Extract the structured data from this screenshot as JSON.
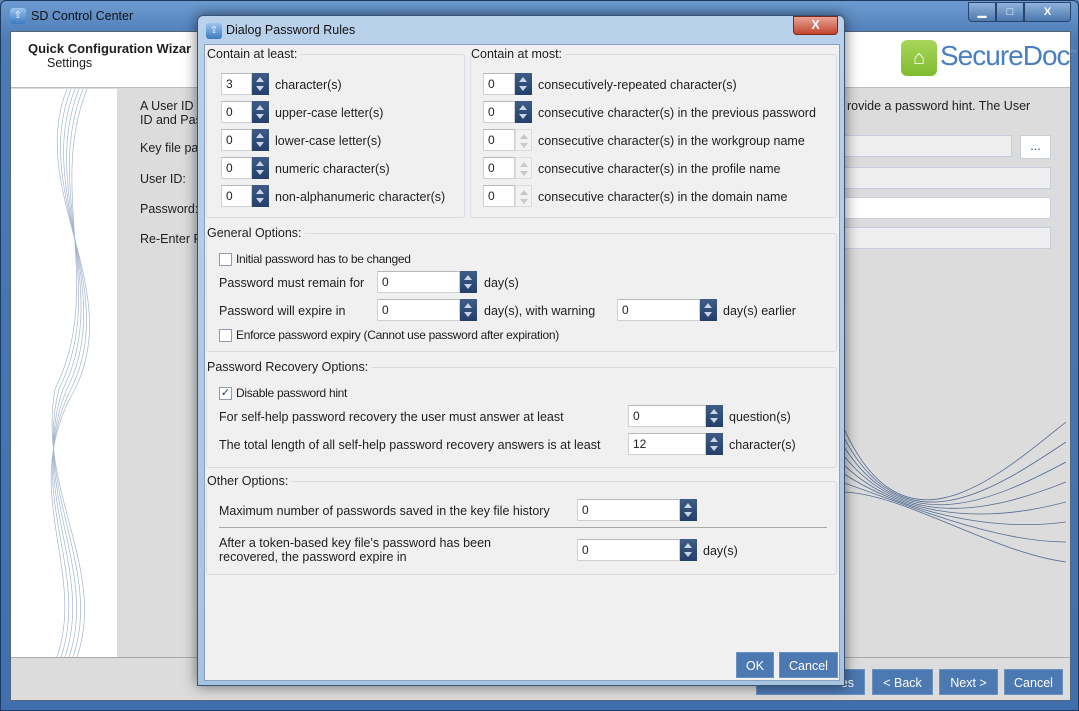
{
  "app": {
    "title": "SD Control Center",
    "window_controls": {
      "minimize": "▁",
      "maximize": "□",
      "close": "X"
    },
    "header": {
      "title": "Quick Configuration Wizar",
      "subtitle": "Settings",
      "logo_text": "SecureDoc",
      "logo_tm": "™"
    },
    "body": {
      "intro_line1_left": "A User ID",
      "intro_line1_right": "rovide a password hint. The User",
      "intro_line2": "ID and Pas",
      "key_file_label": "Key file pa",
      "user_id_label": "User ID:",
      "password_label": "Password:",
      "reenter_label": "Re-Enter P",
      "browse_label": "..."
    },
    "footer": {
      "hidden_button_label": "es",
      "back": "< Back",
      "next": "Next >",
      "cancel": "Cancel"
    }
  },
  "dialog": {
    "title": "Dialog Password Rules",
    "close": "X",
    "contain_least": {
      "legend": "Contain at least:",
      "rows": [
        {
          "value": "3",
          "label": "character(s)"
        },
        {
          "value": "0",
          "label": "upper-case letter(s)"
        },
        {
          "value": "0",
          "label": "lower-case letter(s)"
        },
        {
          "value": "0",
          "label": "numeric character(s)"
        },
        {
          "value": "0",
          "label": "non-alphanumeric character(s)"
        }
      ]
    },
    "contain_most": {
      "legend": "Contain at most:",
      "rows": [
        {
          "value": "0",
          "label": "consecutively-repeated character(s)",
          "enabled": true
        },
        {
          "value": "0",
          "label": "consecutive character(s) in the previous password",
          "enabled": true
        },
        {
          "value": "0",
          "label": "consecutive character(s) in the workgroup name",
          "enabled": false
        },
        {
          "value": "0",
          "label": "consecutive character(s) in the profile name",
          "enabled": false
        },
        {
          "value": "0",
          "label": "consecutive character(s) in the domain name",
          "enabled": false
        }
      ]
    },
    "general": {
      "legend": "General Options:",
      "initial_change": {
        "label": "Initial password has to be changed",
        "checked": false
      },
      "remain_label": "Password must remain for",
      "remain_value": "0",
      "remain_unit": "day(s)",
      "expire_label": "Password will expire in",
      "expire_value": "0",
      "expire_unit": "day(s), with warning",
      "warning_value": "0",
      "warning_unit": "day(s) earlier",
      "enforce": {
        "label": "Enforce password expiry (Cannot use password after expiration)",
        "checked": false
      }
    },
    "recovery": {
      "legend": "Password Recovery Options:",
      "disable_hint": {
        "label": "Disable password hint",
        "checked": true
      },
      "questions_label": "For self-help password recovery the user must answer at least",
      "questions_value": "0",
      "questions_unit": "question(s)",
      "length_label": "The total length of all self-help password recovery answers is at least",
      "length_value": "12",
      "length_unit": "character(s)"
    },
    "other": {
      "legend": "Other Options:",
      "history_label": "Maximum number of passwords saved  in the key file history",
      "history_value": "0",
      "token_label_1": "After a token-based  key file's password has been",
      "token_label_2": "recovered, the password expire in",
      "token_value": "0",
      "token_unit": "day(s)"
    },
    "ok": "OK",
    "cancel": "Cancel"
  },
  "colors": {
    "button": "#4d79b3",
    "spinner": "#2e4b74",
    "logo_green": "#8cc63f",
    "logo_blue": "#4a7fc1"
  }
}
